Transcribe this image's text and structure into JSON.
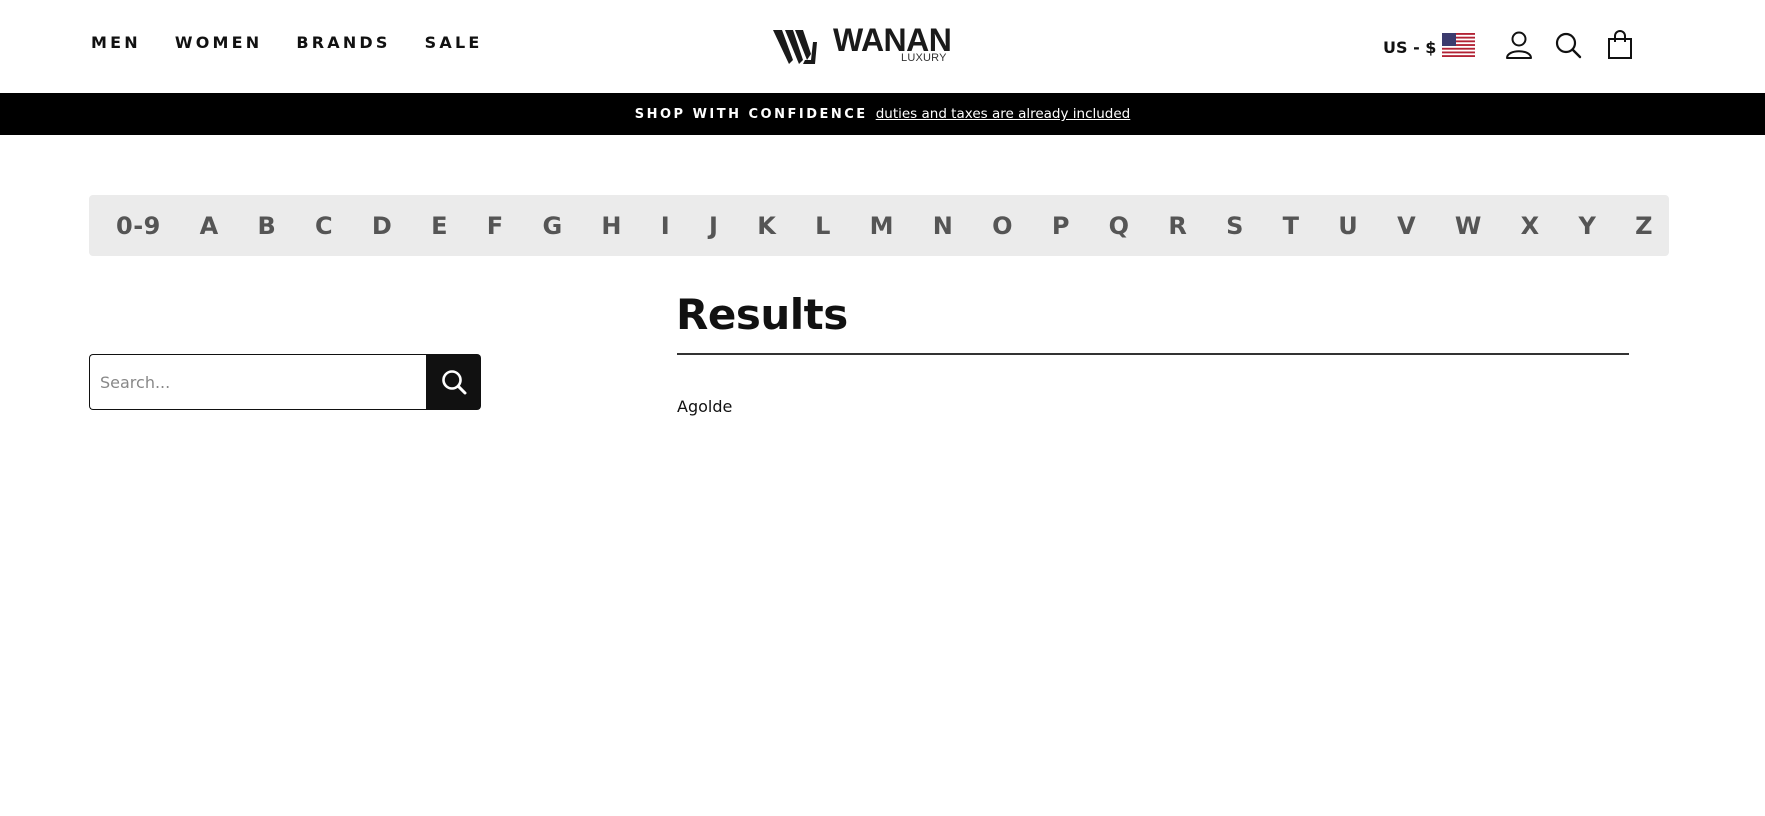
{
  "header": {
    "nav": [
      "MEN",
      "WOMEN",
      "BRANDS",
      "SALE"
    ],
    "logo": {
      "name": "WANAN",
      "sub": "LUXURY"
    },
    "currency": "US - $",
    "icons": [
      "user-icon",
      "search-icon",
      "shopping-bag-icon"
    ]
  },
  "banner": {
    "strong": "SHOP WITH CONFIDENCE",
    "link": "duties and taxes are already included"
  },
  "alphabet": [
    "0-9",
    "A",
    "B",
    "C",
    "D",
    "E",
    "F",
    "G",
    "H",
    "I",
    "J",
    "K",
    "L",
    "M",
    "N",
    "O",
    "P",
    "Q",
    "R",
    "S",
    "T",
    "U",
    "V",
    "W",
    "X",
    "Y",
    "Z"
  ],
  "search": {
    "placeholder": "Search...",
    "value": ""
  },
  "results": {
    "title": "Results",
    "items": [
      "Agolde"
    ]
  },
  "colors": {
    "banner_bg": "#000000",
    "alpha_bg": "#ebebeb",
    "search_btn": "#111111"
  }
}
